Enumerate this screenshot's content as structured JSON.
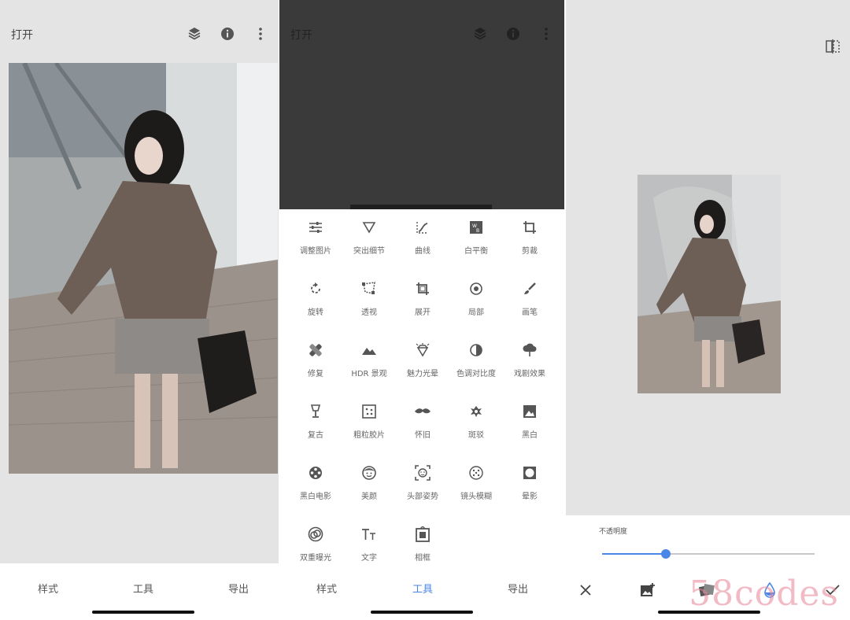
{
  "screen1": {
    "top": {
      "open_label": "打开"
    },
    "bottom_nav": [
      {
        "label": "样式",
        "active": false
      },
      {
        "label": "工具",
        "active": false
      },
      {
        "label": "导出",
        "active": false
      }
    ]
  },
  "screen2": {
    "top": {
      "open_label": "打开"
    },
    "tools": [
      {
        "label": "调整图片",
        "icon": "tune-icon"
      },
      {
        "label": "突出细节",
        "icon": "triangle-icon"
      },
      {
        "label": "曲线",
        "icon": "curves-icon"
      },
      {
        "label": "白平衡",
        "icon": "white-balance-icon"
      },
      {
        "label": "剪裁",
        "icon": "crop-icon"
      },
      {
        "label": "旋转",
        "icon": "rotate-icon"
      },
      {
        "label": "透视",
        "icon": "perspective-icon"
      },
      {
        "label": "展开",
        "icon": "expand-icon"
      },
      {
        "label": "局部",
        "icon": "selective-icon"
      },
      {
        "label": "画笔",
        "icon": "brush-icon"
      },
      {
        "label": "修复",
        "icon": "healing-icon"
      },
      {
        "label": "HDR 景观",
        "icon": "mountain-icon"
      },
      {
        "label": "魅力光晕",
        "icon": "diamond-icon"
      },
      {
        "label": "色调对比度",
        "icon": "tonal-contrast-icon"
      },
      {
        "label": "戏剧效果",
        "icon": "drama-cloud-icon"
      },
      {
        "label": "复古",
        "icon": "lamp-icon"
      },
      {
        "label": "粗粒胶片",
        "icon": "grain-icon"
      },
      {
        "label": "怀旧",
        "icon": "mustache-icon"
      },
      {
        "label": "斑驳",
        "icon": "grunge-icon"
      },
      {
        "label": "黑白",
        "icon": "bw-icon"
      },
      {
        "label": "黑白电影",
        "icon": "film-reel-icon"
      },
      {
        "label": "美颜",
        "icon": "face-icon"
      },
      {
        "label": "头部姿势",
        "icon": "face-frame-icon"
      },
      {
        "label": "镜头模糊",
        "icon": "lens-blur-icon"
      },
      {
        "label": "晕影",
        "icon": "vignette-icon"
      },
      {
        "label": "双重曝光",
        "icon": "double-exposure-icon"
      },
      {
        "label": "文字",
        "icon": "text-icon"
      },
      {
        "label": "相框",
        "icon": "frame-icon"
      }
    ],
    "bottom_nav": [
      {
        "label": "样式",
        "active": false
      },
      {
        "label": "工具",
        "active": true
      },
      {
        "label": "导出",
        "active": false
      }
    ]
  },
  "screen3": {
    "opacity": {
      "label": "不透明度",
      "value": 0.3
    },
    "actions": [
      "close-icon",
      "add-image-icon",
      "blend-mode-icon",
      "opacity-drop-icon",
      "check-icon"
    ],
    "watermark": "58codes"
  },
  "colors": {
    "accent": "#4a86e8",
    "panel_bg": "#e4e4e4",
    "dark_bg": "#3a3a3a"
  }
}
